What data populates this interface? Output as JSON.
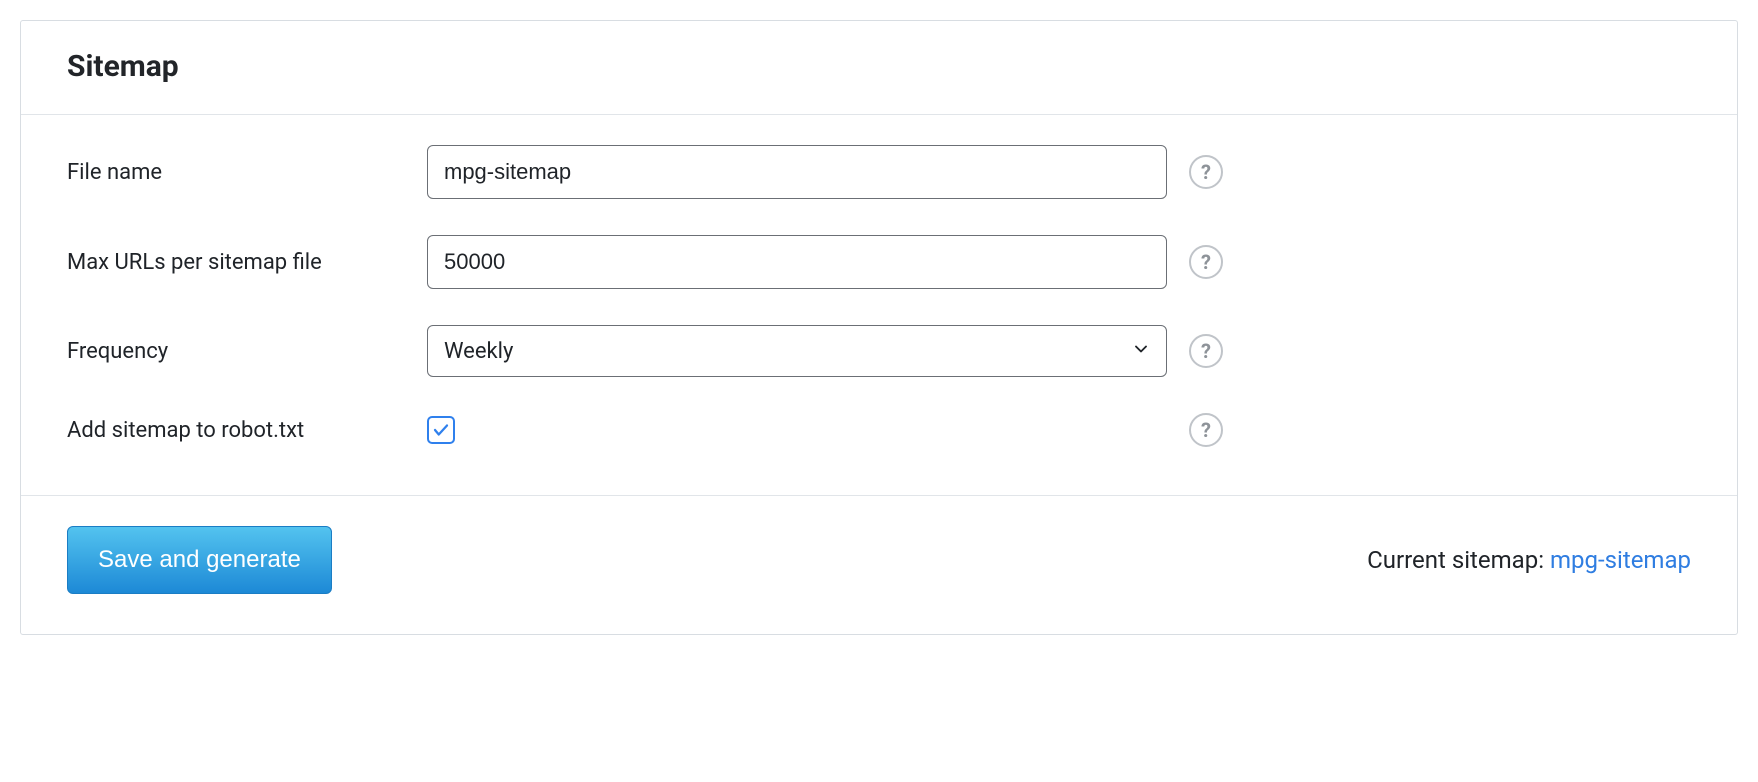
{
  "header": {
    "title": "Sitemap"
  },
  "form": {
    "file_name": {
      "label": "File name",
      "value": "mpg-sitemap"
    },
    "max_urls": {
      "label": "Max URLs per sitemap file",
      "value": "50000"
    },
    "frequency": {
      "label": "Frequency",
      "value": "Weekly"
    },
    "robots": {
      "label": "Add sitemap to robot.txt",
      "checked": true
    }
  },
  "footer": {
    "save_button": "Save and generate",
    "current_label": "Current sitemap: ",
    "current_link": "mpg-sitemap"
  },
  "icons": {
    "help": "?"
  }
}
